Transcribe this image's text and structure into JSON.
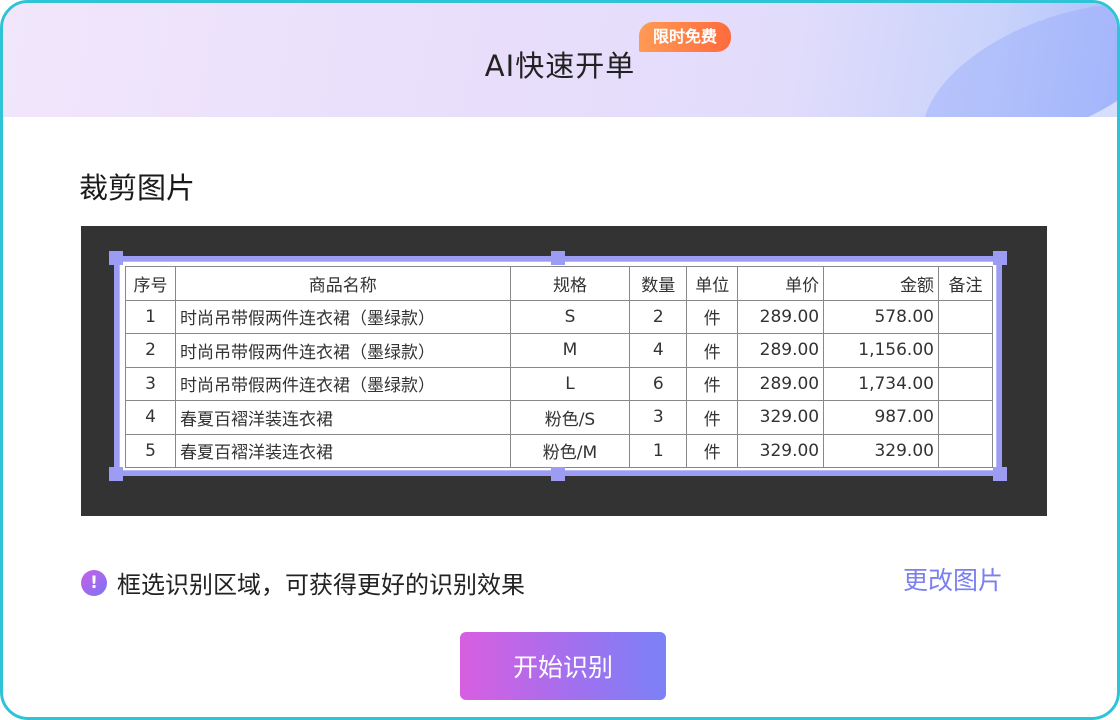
{
  "header": {
    "title": "AI快速开单",
    "badge": "限时免费"
  },
  "section": {
    "title": "裁剪图片"
  },
  "table": {
    "columns": [
      "序号",
      "商品名称",
      "规格",
      "数量",
      "单位",
      "单价",
      "金额",
      "备注"
    ],
    "rows": [
      [
        "1",
        "时尚吊带假两件连衣裙（墨绿款）",
        "S",
        "2",
        "件",
        "289.00",
        "578.00",
        ""
      ],
      [
        "2",
        "时尚吊带假两件连衣裙（墨绿款）",
        "M",
        "4",
        "件",
        "289.00",
        "1,156.00",
        ""
      ],
      [
        "3",
        "时尚吊带假两件连衣裙（墨绿款）",
        "L",
        "6",
        "件",
        "289.00",
        "1,734.00",
        ""
      ],
      [
        "4",
        "春夏百褶洋装连衣裙",
        "粉色/S",
        "3",
        "件",
        "329.00",
        "987.00",
        ""
      ],
      [
        "5",
        "春夏百褶洋装连衣裙",
        "粉色/M",
        "1",
        "件",
        "329.00",
        "329.00",
        ""
      ]
    ]
  },
  "tip": {
    "icon": "exclamation-icon",
    "text": "框选识别区域，可获得更好的识别效果"
  },
  "actions": {
    "change_image": "更改图片",
    "start": "开始识别"
  },
  "colors": {
    "frame_border": "#2ec4d6",
    "accent": "#7b80f0",
    "badge": "#ff7a45",
    "crop_handle": "#9c9cf5"
  }
}
